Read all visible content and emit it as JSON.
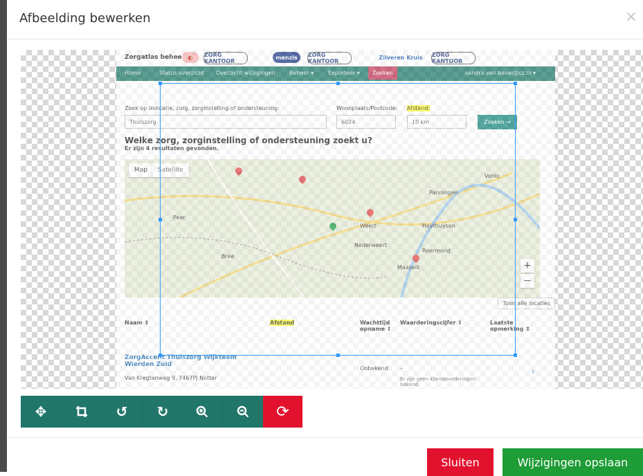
{
  "modal": {
    "title": "Afbeelding bewerken",
    "close_symbol": "×"
  },
  "screenshot": {
    "brand": "Zorgatlas beheer",
    "logos": [
      "ZORG KANTOOR",
      "menzis",
      "ZORG KANTOOR",
      "Zilveren Kruis",
      "ZORG KANTOOR"
    ],
    "nav": {
      "items": [
        "Home",
        "Status overzicht",
        "Overzicht wijzigingen",
        "Beheer ▾",
        "Exporteer ▾",
        "Zoeken"
      ],
      "user": "sandra.van.bavel@cz.nl ▾"
    },
    "search": {
      "label": "Zoek op indicatie, zorg, zorginstelling of ondersteuning:",
      "value": "Thuiszorg",
      "place_label": "Woonplaats/Postcode:",
      "place_value": "6024",
      "distance_label": "Afstand:",
      "distance_value": "10 km",
      "button": "Zoeken →"
    },
    "heading": "Welke zorg, zorginstelling of ondersteuning zoekt u?",
    "subheading": "Er zijn 4 resultaten gevonden.",
    "map": {
      "tab_map": "Map",
      "tab_satellite": "Satellite",
      "show_all": "Toon alle locaties",
      "places": [
        "Weert",
        "Roermond",
        "Nederweert",
        "Maaseik",
        "Bree",
        "Peer",
        "Heythuysen",
        "Panningen",
        "Venlo"
      ]
    },
    "table": {
      "headers": [
        "Naam ⇕",
        "Afstand",
        "Wachttijd opname ⇕",
        "Waarderingscijfer ⇕",
        "Laatste opmerking ⇕"
      ],
      "row": {
        "name": "ZorgAccent Thuiszorg Wijkteam Wierden Zuid",
        "address": "Van Kregtenweg 9, 7467PJ Notter",
        "status": "Onbekend",
        "rating": "–",
        "note": "Er zijn geen klantwaarderingen bekend."
      }
    }
  },
  "toolbar": {
    "groups": [
      [
        "move-icon",
        "crop-icon"
      ],
      [
        "rotate-left-icon",
        "rotate-right-icon"
      ],
      [
        "zoom-in-icon",
        "zoom-out-icon"
      ]
    ],
    "reset": "reset-icon"
  },
  "footer": {
    "close_label": "Sluiten",
    "save_label": "Wijzigingen opslaan"
  },
  "colors": {
    "teal": "#21766a",
    "red": "#e2122f",
    "green": "#1e9c36",
    "crop_border": "#3399ff"
  }
}
